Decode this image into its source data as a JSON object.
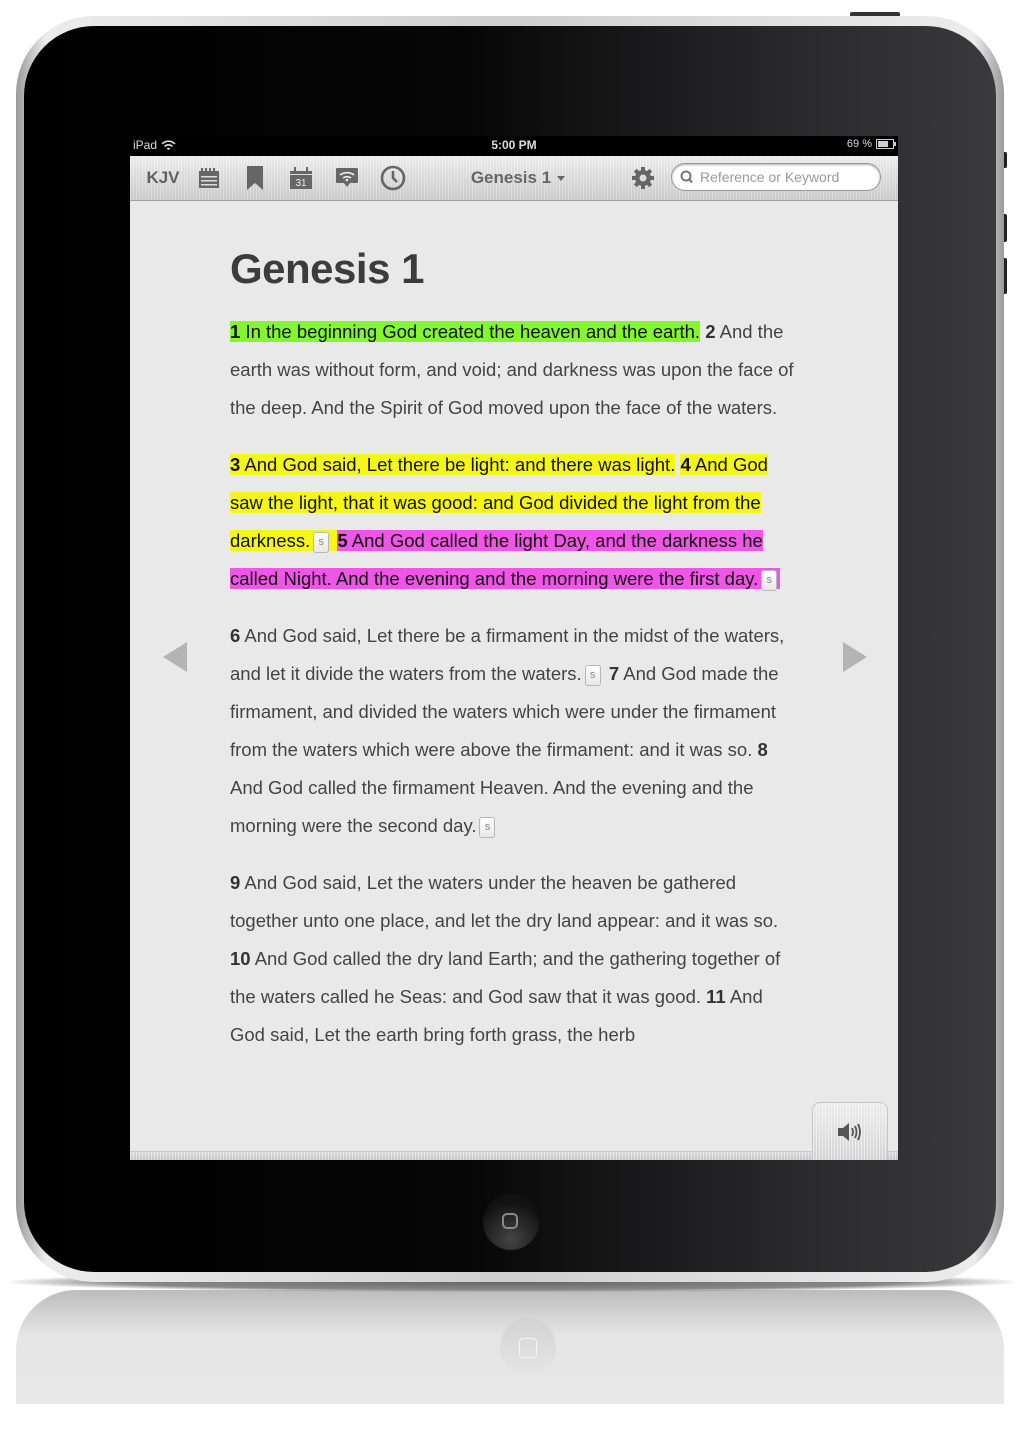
{
  "statusbar": {
    "device": "iPad",
    "time": "5:00 PM",
    "battery_text": "69 %",
    "battery_level": 0.69
  },
  "toolbar": {
    "version_label": "KJV",
    "icons": [
      "plans-icon",
      "bookmark-icon",
      "calendar-icon",
      "chat-icon",
      "history-icon"
    ],
    "calendar_day": "31",
    "chapter_selector": "Genesis 1",
    "settings_icon": "gear-icon",
    "search": {
      "placeholder": "Reference or Keyword",
      "value": ""
    }
  },
  "highlight_colors": {
    "green": "#85f52e",
    "yellow": "#f5f51a",
    "pink": "#f055e8"
  },
  "content": {
    "title": "Genesis 1",
    "note_marker": "s",
    "verses": [
      {
        "n": "1",
        "text": "In the beginning God created the heaven and the earth.",
        "highlight": "green"
      },
      {
        "n": "2",
        "text": "And the earth was without form, and void; and darkness was upon the face of the deep. And the Spirit of God moved upon the face of the waters."
      },
      {
        "n": "3",
        "text": "And God said, Let there be light: and there was light.",
        "highlight": "yellow"
      },
      {
        "n": "4",
        "text": "And God saw the light, that it was good: and God divided the light from the darkness.",
        "highlight": "yellow",
        "note": true
      },
      {
        "n": "5",
        "text": "And God called the light Day, and the darkness he called Night. And the evening and the morning were the first day.",
        "highlight": "pink",
        "note": true
      },
      {
        "n": "6",
        "text": "And God said, Let there be a firmament in the midst of the waters, and let it divide the waters from the waters.",
        "note": true
      },
      {
        "n": "7",
        "text": "And God made the firmament, and divided the waters which were under the firmament from the waters which were above the firmament: and it was so."
      },
      {
        "n": "8",
        "text": "And God called the firmament Heaven. And the evening and the morning were the second day.",
        "note": true
      },
      {
        "n": "9",
        "text": "And God said, Let the waters under the heaven be gathered together unto one place, and let the dry land appear: and it was so."
      },
      {
        "n": "10",
        "text": "And God called the dry land Earth; and the gathering together of the waters called he Seas: and God saw that it was good."
      },
      {
        "n": "11",
        "text": "And God said, Let the earth bring forth grass, the herb"
      }
    ]
  },
  "navigation": {
    "prev_icon": "triangle-left-icon",
    "next_icon": "triangle-right-icon",
    "audio_icon": "speaker-icon"
  }
}
